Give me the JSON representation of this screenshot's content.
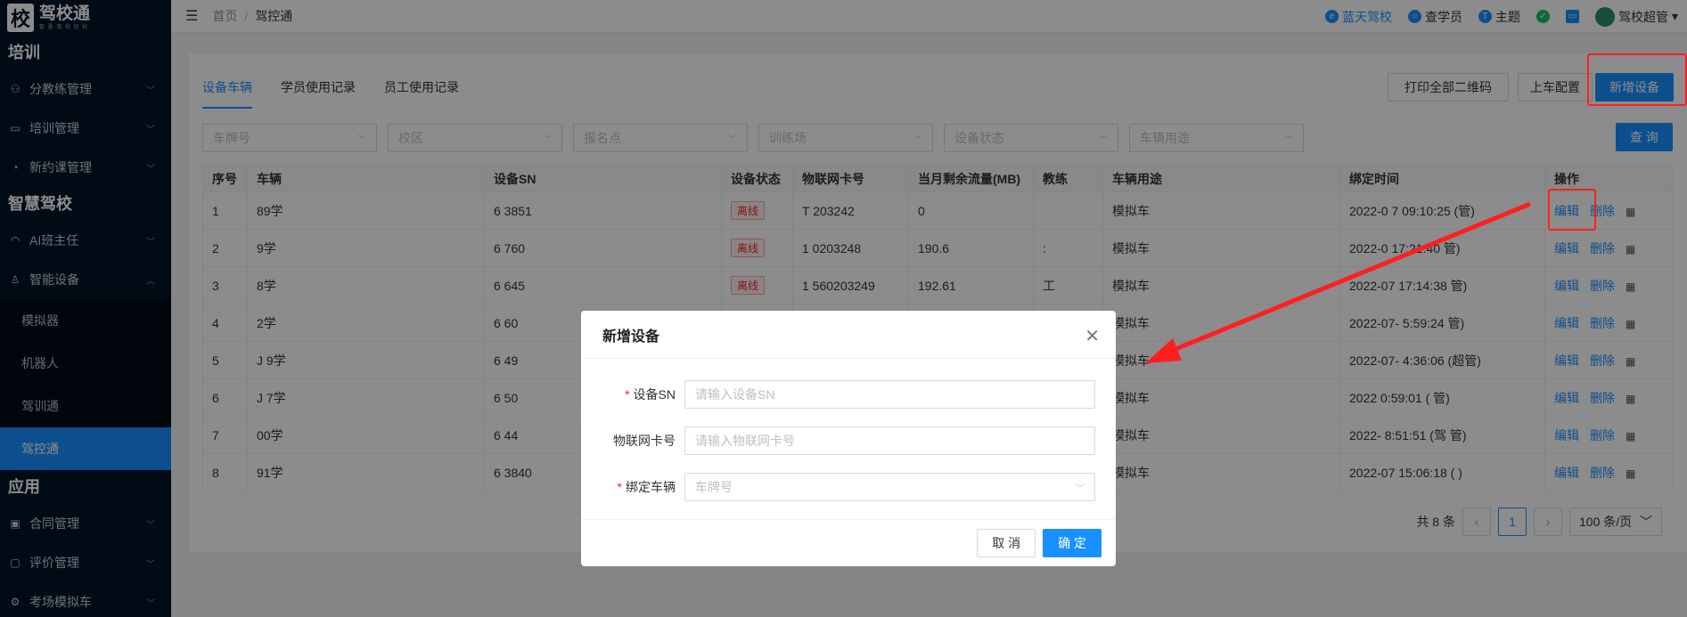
{
  "logo": {
    "mark": "校",
    "title": "驾校通",
    "slogan": "智 慧 驾 校 轻 松"
  },
  "sidebar": {
    "sections": [
      {
        "title": "培训",
        "items": [
          {
            "label": "分教练管理",
            "icon": "team-icon"
          },
          {
            "label": "培训管理",
            "icon": "book-icon"
          },
          {
            "label": "新约课管理",
            "icon": "dashboard-icon"
          }
        ]
      },
      {
        "title": "智慧驾校",
        "items": [
          {
            "label": "AI班主任",
            "icon": "headset-icon"
          },
          {
            "label": "智能设备",
            "icon": "device-icon",
            "expanded": true,
            "children": [
              "模拟器",
              "机器人",
              "驾训通",
              "驾控通"
            ],
            "active_child": "驾控通"
          }
        ]
      },
      {
        "title": "应用",
        "items": [
          {
            "label": "合同管理",
            "icon": "contract-icon"
          },
          {
            "label": "评价管理",
            "icon": "comment-icon"
          },
          {
            "label": "考场模拟车",
            "icon": "car-icon"
          }
        ]
      }
    ]
  },
  "header": {
    "breadcrumb": [
      "首页",
      "驾控通"
    ],
    "right": {
      "school": "蓝天驾校",
      "student": "查学员",
      "theme": "主题",
      "user": "驾校超管"
    }
  },
  "tabs": [
    "设备车辆",
    "学员使用记录",
    "员工使用记录"
  ],
  "toolbar": {
    "print_qr": "打印全部二维码",
    "boarding_config": "上车配置",
    "add_device": "新增设备",
    "query": "查 询"
  },
  "filters": [
    "车牌号",
    "校区",
    "报名点",
    "训练场",
    "设备状态",
    "车辆用途"
  ],
  "table": {
    "columns": [
      "序号",
      "车辆",
      "设备SN",
      "设备状态",
      "物联网卡号",
      "当月剩余流量(MB)",
      "教练",
      "车辆用途",
      "绑定时间",
      "操作"
    ],
    "rows": [
      [
        "1",
        "89学",
        "6 3851",
        "离线",
        "T 203242",
        "0",
        "",
        "模拟车",
        "2022-0 7 09:10:25 (管)"
      ],
      [
        "2",
        "9学",
        "6 760",
        "离线",
        "1 0203248",
        "190.6",
        ":",
        "模拟车",
        "2022-0 17:21:40 管)"
      ],
      [
        "3",
        "8学",
        "6 645",
        "离线",
        "1 560203249",
        "192.61",
        "工",
        "模拟车",
        "2022-07 17:14:38 管)"
      ],
      [
        "4",
        "2学",
        "6 60",
        "",
        "",
        "",
        "",
        "模拟车",
        "2022-07- 5:59:24 管)"
      ],
      [
        "5",
        "J 9学",
        "6 49",
        "",
        "",
        "",
        "",
        "模拟车",
        "2022-07- 4:36:06 (超管)"
      ],
      [
        "6",
        "J 7学",
        "6 50",
        "",
        "",
        "",
        "",
        "模拟车",
        "2022 0:59:01 ( 管)"
      ],
      [
        "7",
        "00学",
        "6 44",
        "",
        "",
        "",
        "",
        "模拟车",
        "2022- 8:51:51 (驾 管)"
      ],
      [
        "8",
        "91学",
        "6 3840",
        "",
        "",
        "",
        "",
        "模拟车",
        "2022-07 15:06:18 ( )"
      ]
    ],
    "ops": {
      "edit": "编辑",
      "delete": "删除"
    }
  },
  "pagination": {
    "total": "共 8 条",
    "current": "1",
    "page_size": "100 条/页"
  },
  "modal": {
    "title": "新增设备",
    "fields": [
      {
        "label": "设备SN",
        "required": true,
        "placeholder": "请输入设备SN"
      },
      {
        "label": "物联网卡号",
        "required": false,
        "placeholder": "请输入物联网卡号"
      },
      {
        "label": "绑定车辆",
        "required": true,
        "placeholder": "车牌号"
      }
    ],
    "cancel": "取 消",
    "ok": "确 定"
  },
  "colors": {
    "primary": "#1890ff",
    "sidebar": "#001529",
    "annotation": "#ff1f1f"
  }
}
